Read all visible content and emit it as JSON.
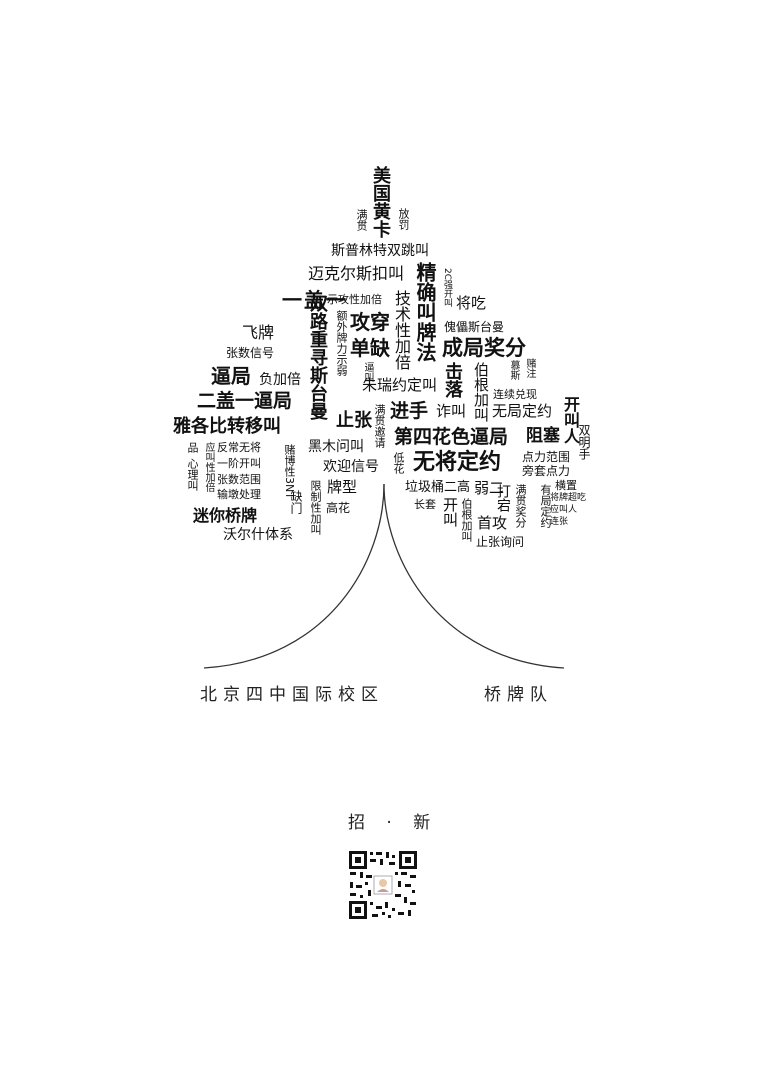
{
  "words": [
    "美国黄卡",
    "满贯",
    "放罚",
    "斯普林特双跳叫",
    "迈克尔斯扣叫",
    "精确叫牌法",
    "2C强开叫",
    "将吃",
    "示攻性加倍",
    "技术性加倍",
    "傀儡斯台曼",
    "一盖一",
    "双路重寻斯台曼",
    "额外牌力示弱",
    "攻",
    "穿",
    "单",
    "缺",
    "飞牌",
    "张数信号",
    "逼叫",
    "成局奖分",
    "逼局",
    "负加倍",
    "朱瑞约定叫",
    "击落",
    "伯根加叫",
    "慕斯",
    "赌注",
    "连续兑现",
    "二盖一逼局",
    "进手",
    "诈叫",
    "无局定约",
    "双明手",
    "开叫人",
    "阻塞",
    "雅各比转移叫",
    "满贯邀请",
    "止张",
    "第四花色逼局",
    "点力范围",
    "品",
    "心理叫",
    "反常无将",
    "一阶开叫",
    "应叫性加倍",
    "张数范围",
    "黑木问叫",
    "欢迎信号",
    "旁套点力",
    "横置",
    "低花",
    "无将定约",
    "输墩处理",
    "赌博性3NT",
    "限制性加叫",
    "牌型",
    "高花",
    "垃圾桶二高",
    "弱二",
    "有局定约",
    "将牌超吃",
    "应叫人",
    "连张",
    "迷你桥牌",
    "长套",
    "开叫",
    "打宕",
    "首攻",
    "伯根加叫",
    "止张询问",
    "满贯奖分",
    "缺门",
    "沃尔什体系"
  ],
  "school": "北京四中国际校区",
  "team": "桥牌队",
  "recruit": "招 · 新"
}
